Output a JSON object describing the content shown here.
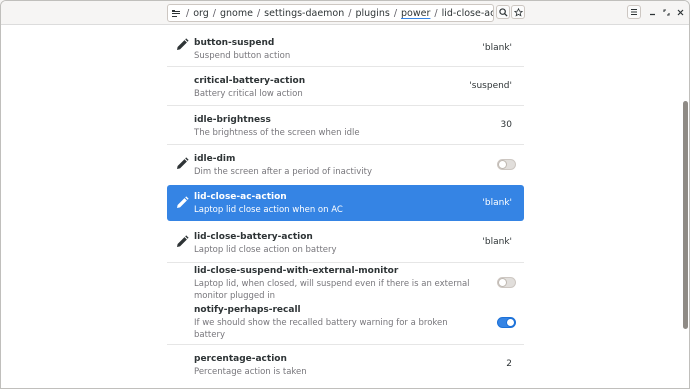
{
  "path": {
    "segments": [
      "org",
      "gnome",
      "settings-daemon",
      "plugins",
      "power",
      "lid-close-ac-action"
    ],
    "active_segment": "power"
  },
  "header": {
    "search_icon": "search-icon",
    "bookmark_icon": "star-icon",
    "menu_icon": "hamburger-menu-icon",
    "minimize_icon": "minimize-icon",
    "maximize_icon": "maximize-icon",
    "close_icon": "close-icon"
  },
  "accent_color": "#3584e4",
  "keys": [
    {
      "name": "button-suspend",
      "description": "Suspend button action",
      "value": "'blank'",
      "edited": true
    },
    {
      "name": "critical-battery-action",
      "description": "Battery critical low action",
      "value": "'suspend'",
      "edited": false
    },
    {
      "name": "idle-brightness",
      "description": "The brightness of the screen when idle",
      "value": "30",
      "edited": false
    },
    {
      "name": "idle-dim",
      "description": "Dim the screen after a period of inactivity",
      "toggle": false,
      "edited": true
    },
    {
      "name": "lid-close-ac-action",
      "description": "Laptop lid close action when on AC",
      "value": "'blank'",
      "edited": true,
      "selected": true
    },
    {
      "name": "lid-close-battery-action",
      "description": "Laptop lid close action on battery",
      "value": "'blank'",
      "edited": true
    },
    {
      "name": "lid-close-suspend-with-external-monitor",
      "description_lines": [
        "Laptop lid, when closed, will suspend even if there is an external",
        "monitor plugged in"
      ],
      "toggle": false,
      "edited": false
    },
    {
      "name": "notify-perhaps-recall",
      "description_lines": [
        "If we should show the recalled battery warning for a broken",
        "battery"
      ],
      "toggle": true,
      "edited": false
    },
    {
      "name": "percentage-action",
      "description": "Percentage action is taken",
      "value": "2",
      "edited": false
    }
  ]
}
